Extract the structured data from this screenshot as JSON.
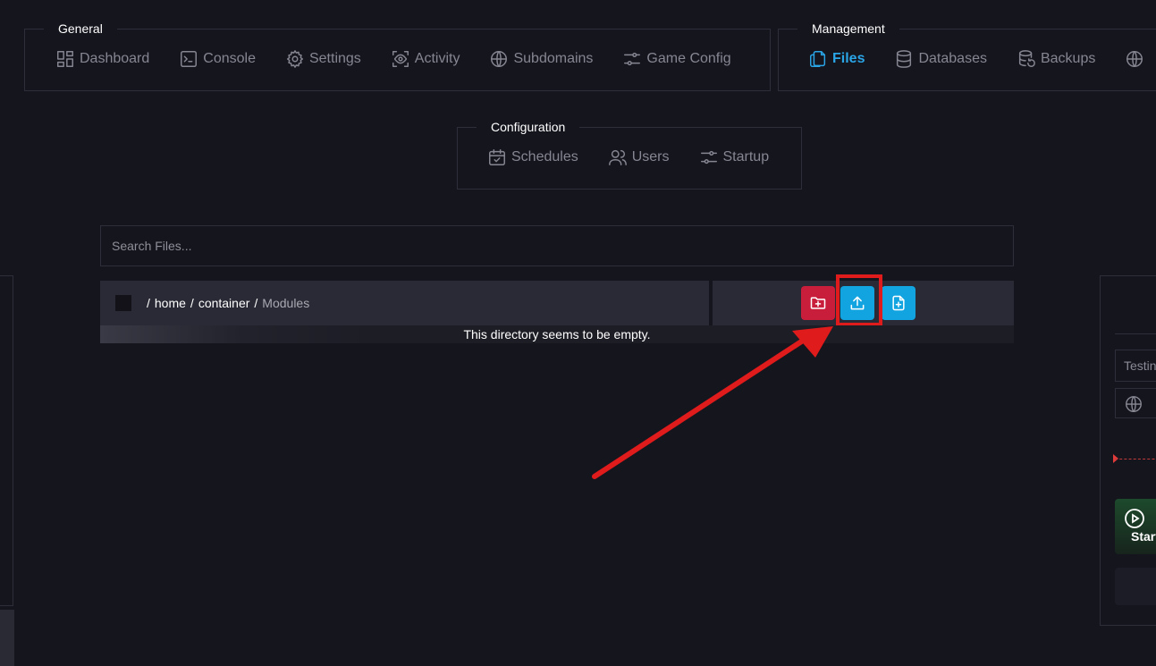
{
  "nav": {
    "general": {
      "title": "General",
      "items": [
        {
          "label": "Dashboard",
          "icon": "dashboard-icon"
        },
        {
          "label": "Console",
          "icon": "terminal-icon"
        },
        {
          "label": "Settings",
          "icon": "gear-icon"
        },
        {
          "label": "Activity",
          "icon": "eye-icon"
        },
        {
          "label": "Subdomains",
          "icon": "globe-icon"
        },
        {
          "label": "Game Config",
          "icon": "sliders-icon"
        }
      ]
    },
    "management": {
      "title": "Management",
      "items": [
        {
          "label": "Files",
          "icon": "files-icon",
          "active": true
        },
        {
          "label": "Databases",
          "icon": "database-icon"
        },
        {
          "label": "Backups",
          "icon": "backup-icon"
        }
      ]
    },
    "configuration": {
      "title": "Configuration",
      "items": [
        {
          "label": "Schedules",
          "icon": "calendar-icon"
        },
        {
          "label": "Users",
          "icon": "users-icon"
        },
        {
          "label": "Startup",
          "icon": "sliders-icon"
        }
      ]
    }
  },
  "files": {
    "search_placeholder": "Search Files...",
    "path": {
      "segments": [
        "home",
        "container"
      ],
      "current": "Modules",
      "separator": "/"
    },
    "empty_message": "This directory seems to be empty.",
    "actions": {
      "new_folder": "folder-plus-icon",
      "upload": "upload-icon",
      "new_file": "file-plus-icon"
    }
  },
  "right_panel": {
    "name_value": "Testing",
    "start_label": "Start"
  },
  "colors": {
    "background": "#15151e",
    "accent": "#2aa5e6",
    "danger": "#c81e3c",
    "annotation": "#e01b1b"
  }
}
